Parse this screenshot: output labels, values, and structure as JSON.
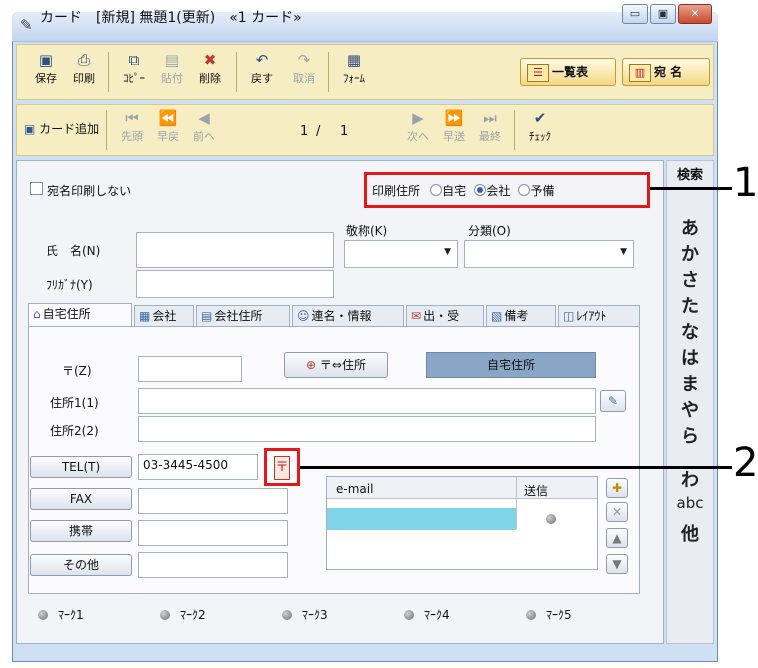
{
  "window": {
    "title": "カード　[新規] 無題1(更新)　«1 カード»",
    "controls": {
      "minimize": "▭",
      "restore": "▣",
      "close": "✕"
    }
  },
  "toolbar": {
    "buttons": [
      {
        "label": "保存",
        "icon": "save-icon",
        "enabled": true
      },
      {
        "label": "印刷",
        "icon": "print-icon",
        "enabled": true
      },
      {
        "label": "ｺﾋﾟｰ",
        "icon": "copy-icon",
        "enabled": true
      },
      {
        "label": "貼付",
        "icon": "paste-icon",
        "enabled": false
      },
      {
        "label": "削除",
        "icon": "delete-icon",
        "enabled": true
      },
      {
        "label": "戻す",
        "icon": "undo-icon",
        "enabled": true
      },
      {
        "label": "取消",
        "icon": "cancel-icon",
        "enabled": false
      },
      {
        "label": "ﾌｫｰﾑ",
        "icon": "form-icon",
        "enabled": true
      }
    ],
    "list_button": "一覧表",
    "address_button": "宛 名"
  },
  "navbar": {
    "add_card": "カード追加",
    "first": "先頭",
    "fast_back": "早戻",
    "prev": "前へ",
    "page_current": "1",
    "page_sep": "/",
    "page_total": "1",
    "next": "次へ",
    "fast_fwd": "早送",
    "last": "最終",
    "check": "ﾁｪｯｸ"
  },
  "form": {
    "no_address_print": "宛名印刷しない",
    "print_address_label": "印刷住所",
    "print_address_options": [
      {
        "label": "自宅",
        "selected": false
      },
      {
        "label": "会社",
        "selected": true
      },
      {
        "label": "予備",
        "selected": false
      }
    ],
    "honorific_label": "敬称(K)",
    "category_label": "分類(O)",
    "name_label": "氏　名(N)",
    "furigana_label": "ﾌﾘｶﾞﾅ(Y)",
    "name_value": "",
    "furigana_value": ""
  },
  "tabs": [
    {
      "label": "自宅住所",
      "icon": "house-icon",
      "active": true
    },
    {
      "label": "会社",
      "icon": "building-icon",
      "active": false
    },
    {
      "label": "会社住所",
      "icon": "office-address-icon",
      "active": false
    },
    {
      "label": "連名・情報",
      "icon": "people-icon",
      "active": false
    },
    {
      "label": "出・受",
      "icon": "mail-icon",
      "active": false
    },
    {
      "label": "備考",
      "icon": "note-icon",
      "active": false
    },
    {
      "label": "ﾚｲｱｳﾄ",
      "icon": "layout-icon",
      "active": false
    }
  ],
  "address": {
    "zip_label": "〒(Z)",
    "zip_value": "",
    "zip_convert_button": "〒⇔住所",
    "type_label": "自宅住所",
    "addr1_label": "住所1(1)",
    "addr2_label": "住所2(2)",
    "addr1_value": "",
    "addr2_value": ""
  },
  "contact": {
    "tel_button": "TEL(T)",
    "tel_value": "03-3445-4500",
    "fax_button": "FAX",
    "mobile_button": "携帯",
    "other_button": "その他"
  },
  "email_table": {
    "headers": [
      "e-mail",
      "送信"
    ]
  },
  "marks": [
    "ﾏｰｸ1",
    "ﾏｰｸ2",
    "ﾏｰｸ3",
    "ﾏｰｸ4",
    "ﾏｰｸ5"
  ],
  "sidebar": {
    "search": "検索",
    "kana": [
      "あ",
      "か",
      "さ",
      "た",
      "な",
      "は",
      "ま",
      "や",
      "ら",
      "わ",
      "abc",
      "他"
    ]
  },
  "callouts": [
    "1",
    "2"
  ]
}
